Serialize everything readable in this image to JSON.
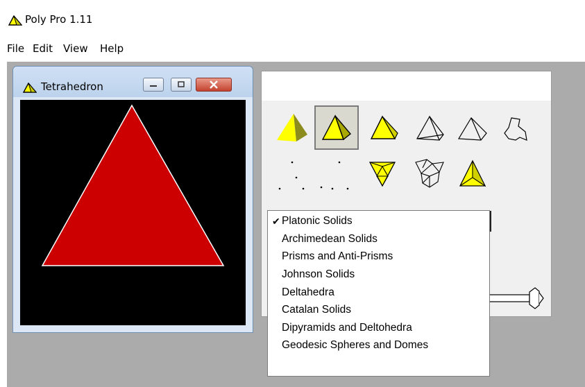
{
  "app": {
    "title": "Poly Pro 1.11",
    "icon": "pyramid-icon"
  },
  "menu": [
    "File",
    "Edit",
    "View",
    "Help"
  ],
  "child_window": {
    "title": "Tetrahedron",
    "buttons": [
      "minimize",
      "maximize",
      "close"
    ],
    "shape_color": "#cc0000"
  },
  "dropdown": {
    "selected_index": 0,
    "items": [
      "Platonic Solids",
      "Archimedean Solids",
      "Prisms and Anti-Prisms",
      "Johnson Solids",
      "Deltahedra",
      "Catalan Solids",
      "Dipyramids and Deltohedra",
      "Geodesic Spheres and Domes"
    ]
  },
  "colors": {
    "yellow": "#ffff00",
    "workspace": "#ababab",
    "red": "#cc0000"
  }
}
